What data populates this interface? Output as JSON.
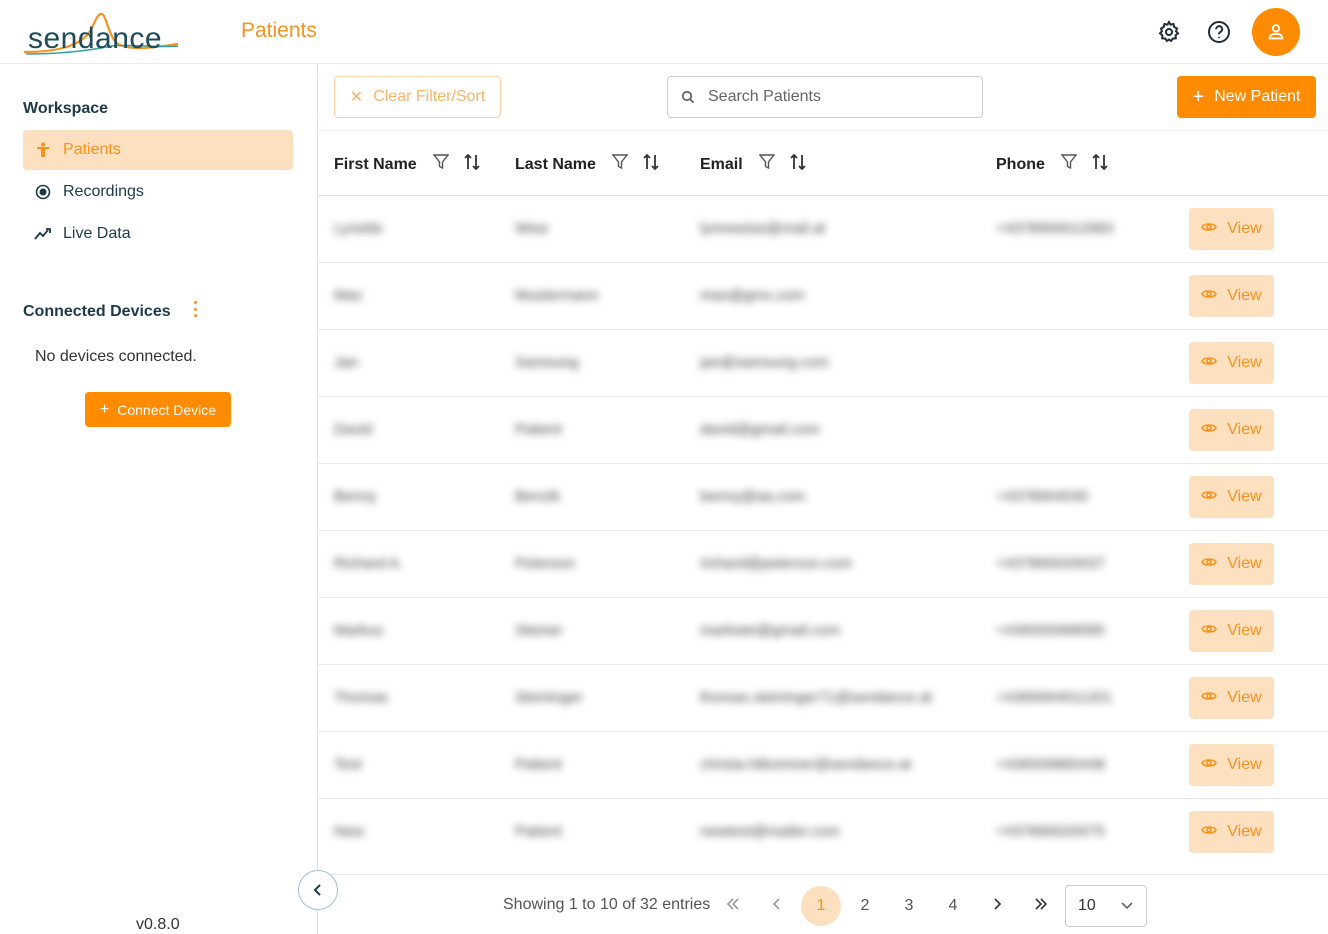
{
  "header": {
    "logo_text": "sendance",
    "page_title": "Patients",
    "icons": [
      "gear-icon",
      "help-icon",
      "user-icon"
    ]
  },
  "sidebar": {
    "workspace_title": "Workspace",
    "items": [
      {
        "label": "Patients",
        "icon": "person-icon",
        "active": true
      },
      {
        "label": "Recordings",
        "icon": "record-icon",
        "active": false
      },
      {
        "label": "Live Data",
        "icon": "live-chart-icon",
        "active": false
      }
    ],
    "devices_title": "Connected Devices",
    "no_devices": "No devices connected.",
    "connect_label": "Connect Device",
    "version": "v0.8.0"
  },
  "toolbar": {
    "clear_label": "Clear Filter/Sort",
    "search_placeholder": "Search Patients",
    "search_value": "",
    "new_label": "New Patient"
  },
  "table": {
    "columns": [
      "First Name",
      "Last Name",
      "Email",
      "Phone"
    ],
    "view_label": "View",
    "rows": [
      {
        "first": "Lynette",
        "last": "Wise",
        "email": "lynnewise@mail.at",
        "phone": "+4378900012983"
      },
      {
        "first": "Max",
        "last": "Mustermann",
        "email": "max@gmx.com",
        "phone": ""
      },
      {
        "first": "Jan",
        "last": "Samsung",
        "email": "jan@samsung.com",
        "phone": ""
      },
      {
        "first": "David",
        "last": "Patient",
        "email": "david@gmail.com",
        "phone": ""
      },
      {
        "first": "Benny",
        "last": "Benzik",
        "email": "benny@aa.com",
        "phone": "+4378904530"
      },
      {
        "first": "Richard A.",
        "last": "Peterson",
        "email": "richard@peterson.com",
        "phone": "+437890020037"
      },
      {
        "first": "Markus",
        "last": "Steiner",
        "email": "markstei@gmail.com",
        "phone": "+436505998585"
      },
      {
        "first": "Thomas",
        "last": "Steininger",
        "email": "thomas.steininger71@sendance.at",
        "phone": "+4369064911201"
      },
      {
        "first": "Test",
        "last": "Patient",
        "email": "christa.hiltommer@sendance.at",
        "phone": "+436509860448"
      },
      {
        "first": "New",
        "last": "Patient",
        "email": "newtest@mailer.com",
        "phone": "+437890020075"
      }
    ]
  },
  "pagination": {
    "showing": "Showing 1 to 10 of 32 entries",
    "pages": [
      "1",
      "2",
      "3",
      "4"
    ],
    "current": "1",
    "per_page": "10"
  },
  "colors": {
    "accent": "#ff8c00",
    "accent_light": "#fde0c0",
    "accent_text": "#f7931e",
    "dark_text": "#1e3a4a"
  }
}
